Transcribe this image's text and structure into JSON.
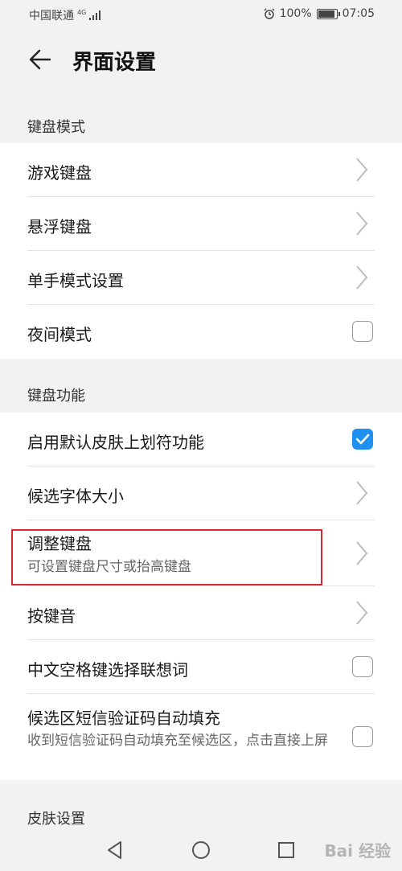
{
  "status": {
    "carrier": "中国联通",
    "network": "4G",
    "battery": "100%",
    "battery_level": 1.0,
    "time": "07:05"
  },
  "header": {
    "title": "界面设置"
  },
  "sections": {
    "keyboard_mode": {
      "title": "键盘模式",
      "items": [
        {
          "label": "游戏键盘"
        },
        {
          "label": "悬浮键盘"
        },
        {
          "label": "单手模式设置"
        },
        {
          "label": "夜间模式",
          "checked": false
        }
      ]
    },
    "keyboard_function": {
      "title": "键盘功能",
      "items": [
        {
          "label": "启用默认皮肤上划符功能",
          "checked": true
        },
        {
          "label": "候选字体大小"
        },
        {
          "label": "调整键盘",
          "sub": "可设置键盘尺寸或抬高键盘"
        },
        {
          "label": "按键音"
        },
        {
          "label": "中文空格键选择联想词",
          "checked": false
        },
        {
          "label": "候选区短信验证码自动填充",
          "sub": "收到短信验证码自动填充至候选区，点击直接上屏",
          "checked": false
        }
      ]
    },
    "skin": {
      "title": "皮肤设置"
    }
  },
  "watermark": "Bai 经验",
  "colors": {
    "accent": "#1f8ff0",
    "highlight": "#d9272e"
  }
}
